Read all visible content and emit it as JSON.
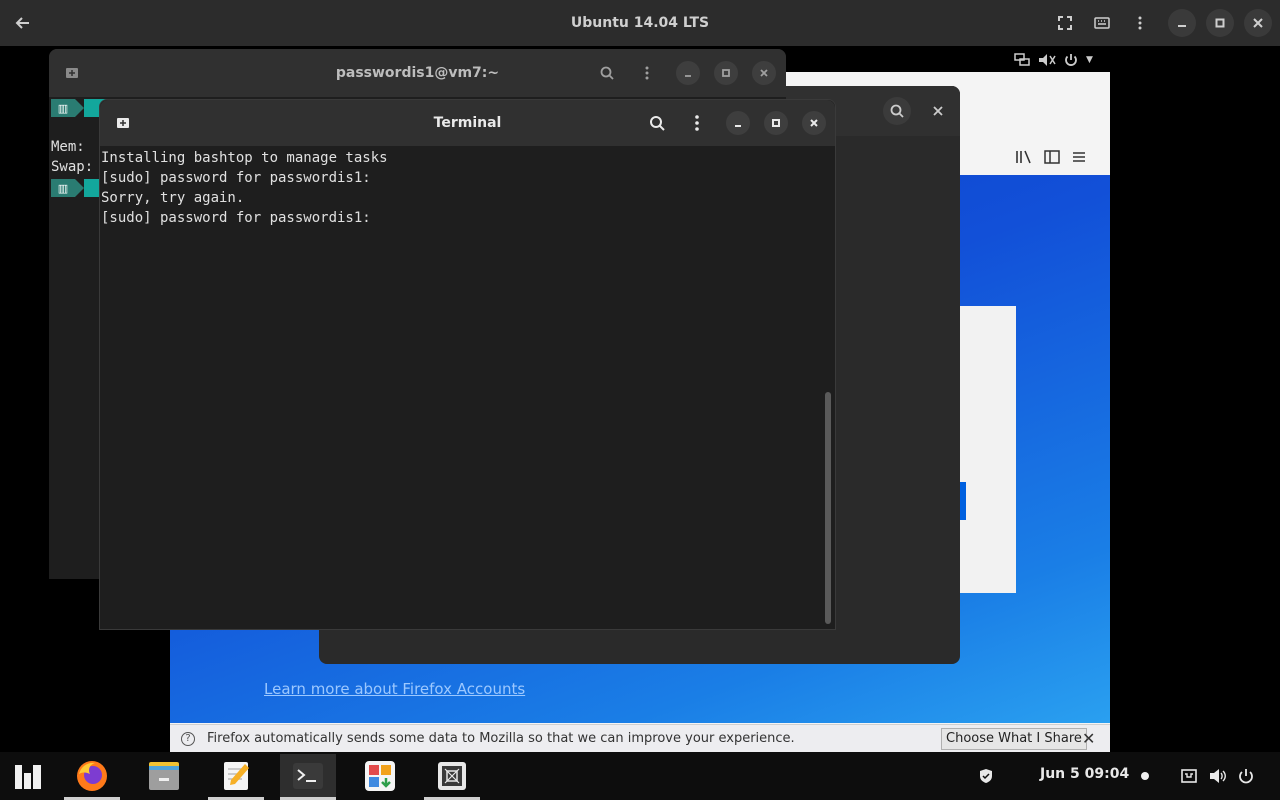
{
  "host": {
    "title": "Ubuntu 14.04 LTS",
    "icons": [
      "back-arrow-icon",
      "fullscreen-icon",
      "keyboard-icon",
      "more-vertical-icon",
      "minimize-icon",
      "maximize-icon",
      "close-icon"
    ]
  },
  "firefox": {
    "learn_link": "Learn more about Firefox Accounts",
    "notice_text": "Firefox automatically sends some data to Mozilla so that we can improve your experience.",
    "notice_button": "Choose What I Share",
    "accent": "#0060df"
  },
  "terminal_back": {
    "title": "passwordis1@vm7:~",
    "mem_label": "Mem:",
    "swap_label": "Swap:"
  },
  "terminal_front": {
    "title": "Terminal",
    "lines": [
      "Installing bashtop to manage tasks",
      "[sudo] password for passwordis1:",
      "Sorry, try again.",
      "[sudo] password for passwordis1:"
    ]
  },
  "taskbar": {
    "apps": [
      "show-apps-icon",
      "firefox-icon",
      "files-icon",
      "text-editor-icon",
      "terminal-icon",
      "software-center-icon",
      "screenshot-icon"
    ],
    "clock": "Jun 5  09:04",
    "colors": {
      "active": "#2e2e2e",
      "indicator": "#cfcfcf"
    }
  }
}
